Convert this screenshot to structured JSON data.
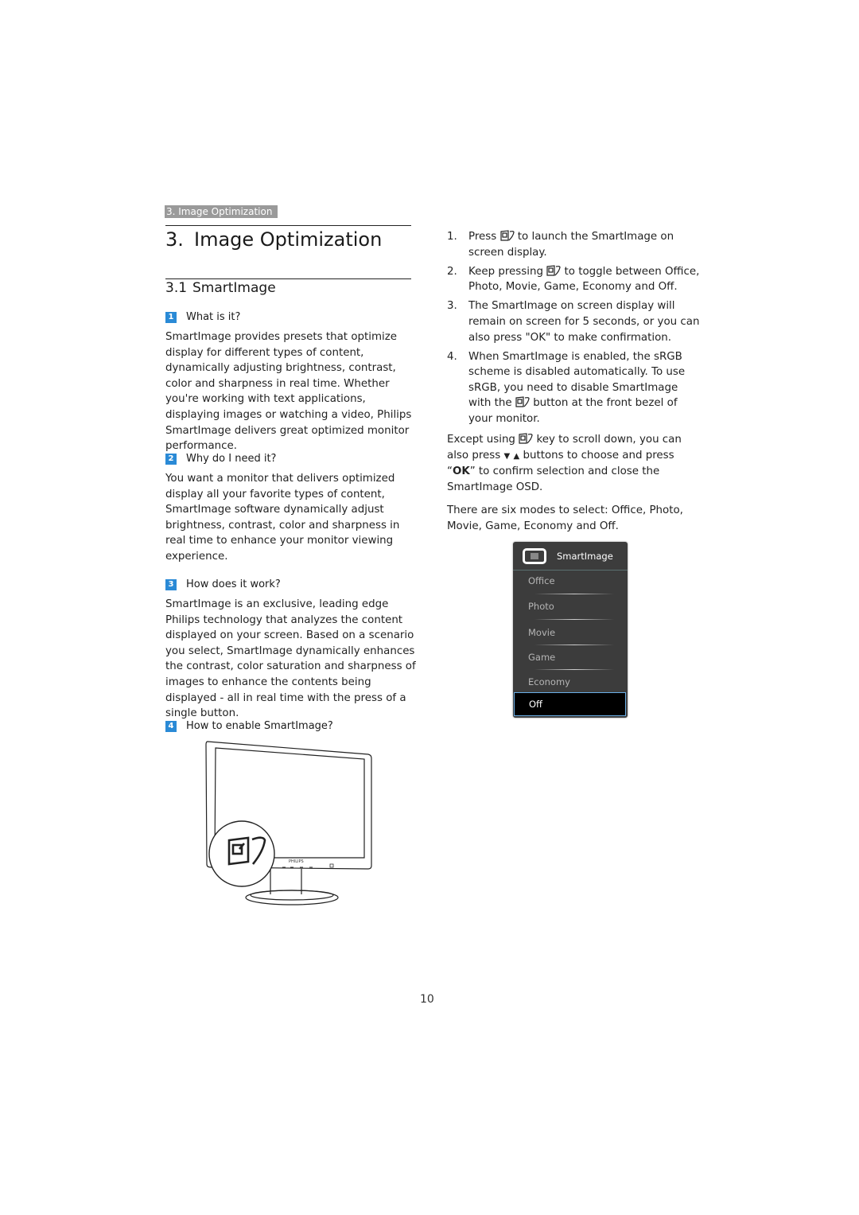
{
  "breadcrumb": "3. Image Optimization",
  "chapter": {
    "number": "3.",
    "title": "Image Optimization"
  },
  "section": {
    "number": "3.1",
    "title": "SmartImage"
  },
  "questions": [
    {
      "badge": "1",
      "heading": "What is it?",
      "body": "SmartImage provides presets that optimize display for different types of content, dynamically adjusting brightness, contrast, color and sharpness in real time. Whether you're working with text applications, displaying images or watching a video, Philips SmartImage delivers great optimized monitor performance."
    },
    {
      "badge": "2",
      "heading": "Why do I need it?",
      "body": "You want a monitor that delivers optimized display all your favorite types of content, SmartImage software dynamically adjust brightness, contrast, color and sharpness in real time to enhance your monitor viewing experience."
    },
    {
      "badge": "3",
      "heading": "How does it work?",
      "body": "SmartImage is an exclusive, leading edge Philips technology that analyzes the content displayed on your screen. Based on a scenario you select, SmartImage dynamically enhances the contrast, color saturation and sharpness of images to enhance the contents being displayed - all in real time with the press of a single button."
    },
    {
      "badge": "4",
      "heading": "How to enable SmartImage?"
    }
  ],
  "steps": [
    {
      "n": "1.",
      "before": "Press",
      "after": "to launch the SmartImage on screen display."
    },
    {
      "n": "2.",
      "before": "Keep pressing",
      "after": "to toggle between Office, Photo, Movie, Game, Economy and Off."
    },
    {
      "n": "3.",
      "before": "The SmartImage on screen display will remain on screen for 5 seconds, or you can also press \"OK\" to make confirmation.",
      "after": ""
    },
    {
      "n": "4.",
      "before": "When SmartImage is enabled, the sRGB scheme is disabled automatically. To use sRGB, you need to disable SmartImage with the",
      "after": "button at the front bezel of your monitor."
    }
  ],
  "except_para": {
    "p1": "Except using",
    "p2": "key to scroll down, you can also press",
    "down": "▼",
    "up": "▲",
    "p3": "buttons to choose and press “",
    "ok": "OK",
    "p4": "” to confirm selection and close the SmartImage OSD."
  },
  "modes_para": "There are six modes to select: Office, Photo, Movie, Game, Economy and Off.",
  "osd": {
    "title": "SmartImage",
    "items": [
      "Office",
      "Photo",
      "Movie",
      "Game",
      "Economy"
    ],
    "selected": "Off",
    "colors": {
      "background": "#3c3c3c",
      "selected_bg": "#000000",
      "selected_border": "#6aaee6"
    }
  },
  "monitor_brand": "PHILIPS",
  "page_number": "10",
  "colors": {
    "badge": "#2a8ad6",
    "breadcrumb_bg": "#9a9a9a"
  }
}
